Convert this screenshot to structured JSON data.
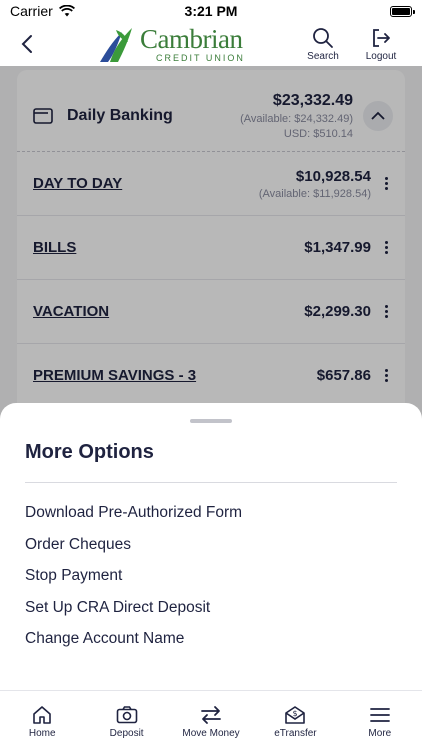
{
  "status_bar": {
    "carrier": "Carrier",
    "time": "3:21 PM"
  },
  "header": {
    "brand_name": "Cambrian",
    "brand_sub": "CREDIT UNION",
    "search_label": "Search",
    "logout_label": "Logout"
  },
  "daily_banking": {
    "title": "Daily Banking",
    "balance": "$23,332.49",
    "available": "(Available: $24,332.49)",
    "usd": "USD: $510.14"
  },
  "accounts": [
    {
      "name": "DAY TO DAY",
      "balance": "$10,928.54",
      "available": "(Available: $11,928.54)"
    },
    {
      "name": "BILLS",
      "balance": "$1,347.99"
    },
    {
      "name": "VACATION",
      "balance": "$2,299.30"
    },
    {
      "name": "PREMIUM SAVINGS - 3",
      "balance": "$657.86"
    }
  ],
  "sheet": {
    "title": "More Options",
    "items": [
      "Download Pre-Authorized Form",
      "Order Cheques",
      "Stop Payment",
      "Set Up CRA Direct Deposit",
      "Change Account Name"
    ]
  },
  "tabs": [
    {
      "label": "Home",
      "icon": "home-icon"
    },
    {
      "label": "Deposit",
      "icon": "camera-icon"
    },
    {
      "label": "Move Money",
      "icon": "transfer-arrows-icon"
    },
    {
      "label": "eTransfer",
      "icon": "etransfer-icon"
    },
    {
      "label": "More",
      "icon": "menu-icon"
    }
  ],
  "colors": {
    "brand_green": "#3b7d3a",
    "brand_blue": "#2b4d9a",
    "text_navy": "#1f2340"
  }
}
